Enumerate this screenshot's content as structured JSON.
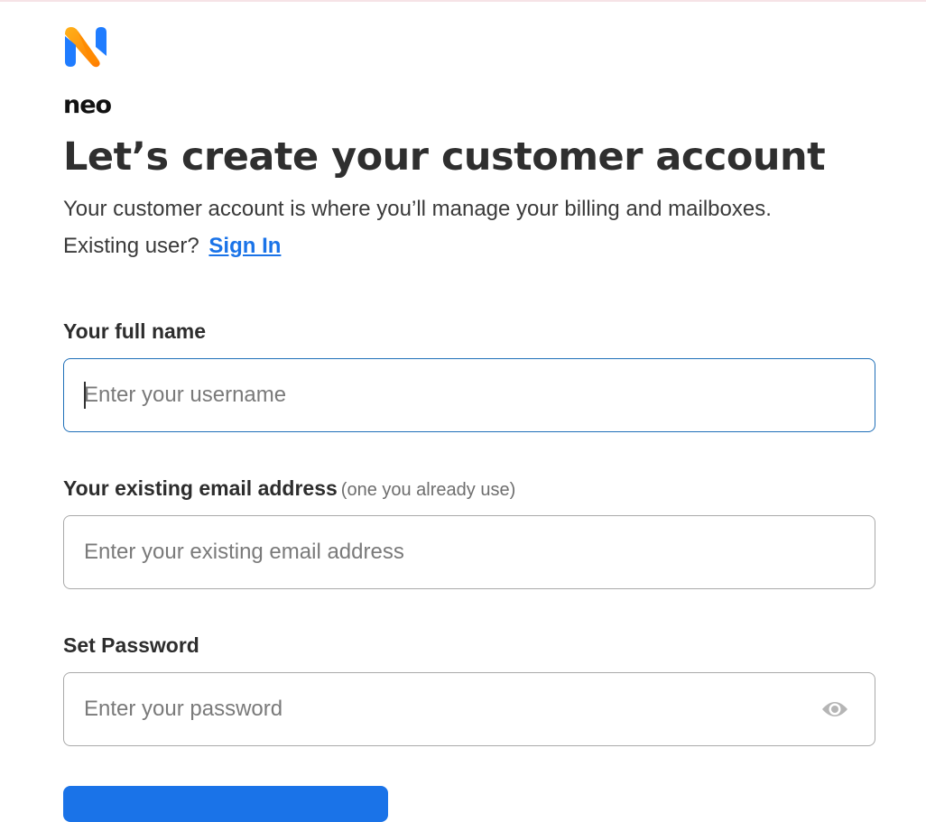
{
  "brand": {
    "logo_text": "neo",
    "colors": {
      "accent_blue": "#1a73e8",
      "logo_orange": "#ff8a00",
      "logo_blue": "#1f7cff"
    }
  },
  "header": {
    "title": "Let’s create your customer account",
    "subtitle": "Your customer account is where you’ll manage your billing and mailboxes.",
    "existing_prompt": "Existing user?",
    "signin_label": "Sign In"
  },
  "form": {
    "full_name": {
      "label": "Your full name",
      "placeholder": "Enter your username",
      "value": ""
    },
    "email": {
      "label": "Your existing email address",
      "hint": "(one you already use)",
      "placeholder": "Enter your existing email address",
      "value": ""
    },
    "password": {
      "label": "Set Password",
      "placeholder": "Enter your password",
      "value": "",
      "toggle_icon": "eye-icon"
    }
  }
}
